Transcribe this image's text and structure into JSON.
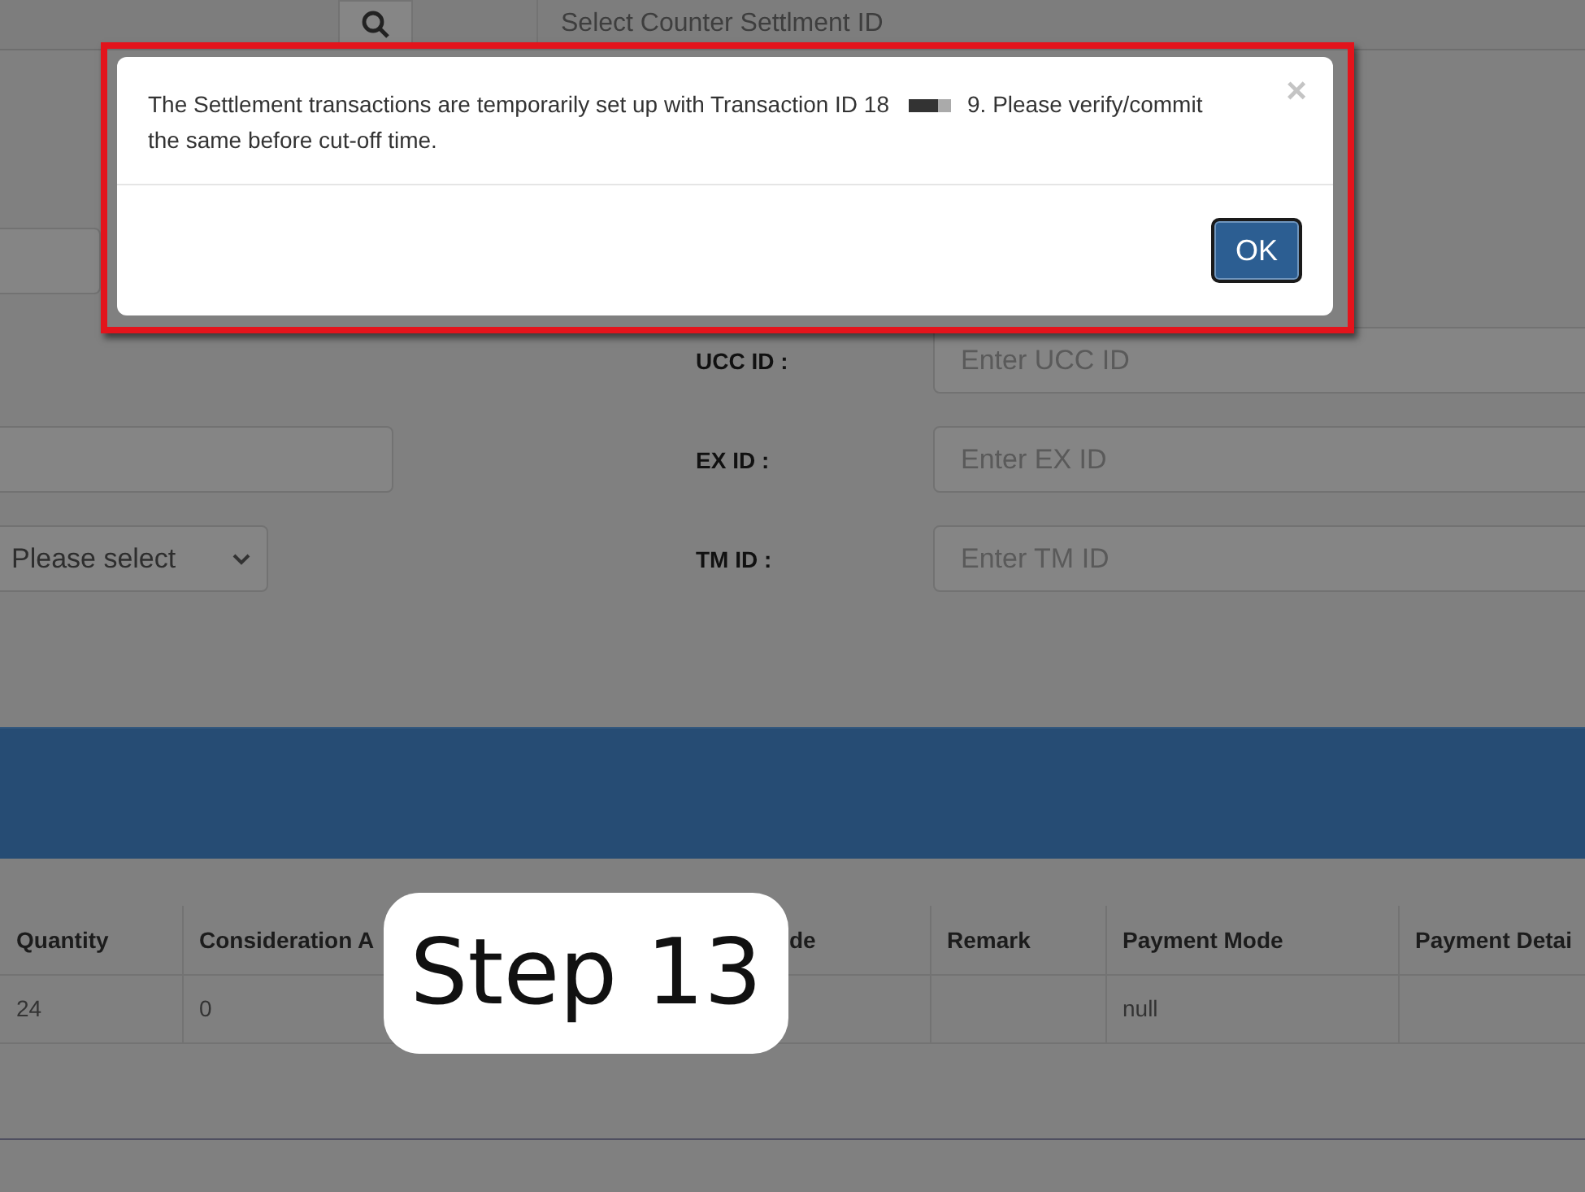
{
  "top_bar": {
    "search_placeholder": "Select Counter Settlment ID"
  },
  "form": {
    "rows": [
      {
        "kind": "blank"
      },
      {
        "kind": "text",
        "label": "UCC ID :",
        "placeholder": "Enter UCC ID"
      },
      {
        "kind": "input",
        "label": "EX ID :",
        "placeholder": "Enter EX ID"
      },
      {
        "kind": "select",
        "value": "Please select",
        "label": "TM ID :",
        "placeholder": "Enter TM ID"
      }
    ]
  },
  "table": {
    "columns": [
      "Quantity",
      "Consideration A",
      "de",
      "Remark",
      "Payment Mode",
      "Payment Detai"
    ],
    "rows": [
      {
        "quantity": "24",
        "consideration": "0",
        "payment_mode": "null"
      }
    ]
  },
  "dialog": {
    "message_start": "The Settlement transactions are temporarily set up with Transaction ID 18",
    "message_end": "9. Please verify/commit the same before cut-off time.",
    "close": "×",
    "ok": "OK"
  },
  "step_badge": "Step 13"
}
